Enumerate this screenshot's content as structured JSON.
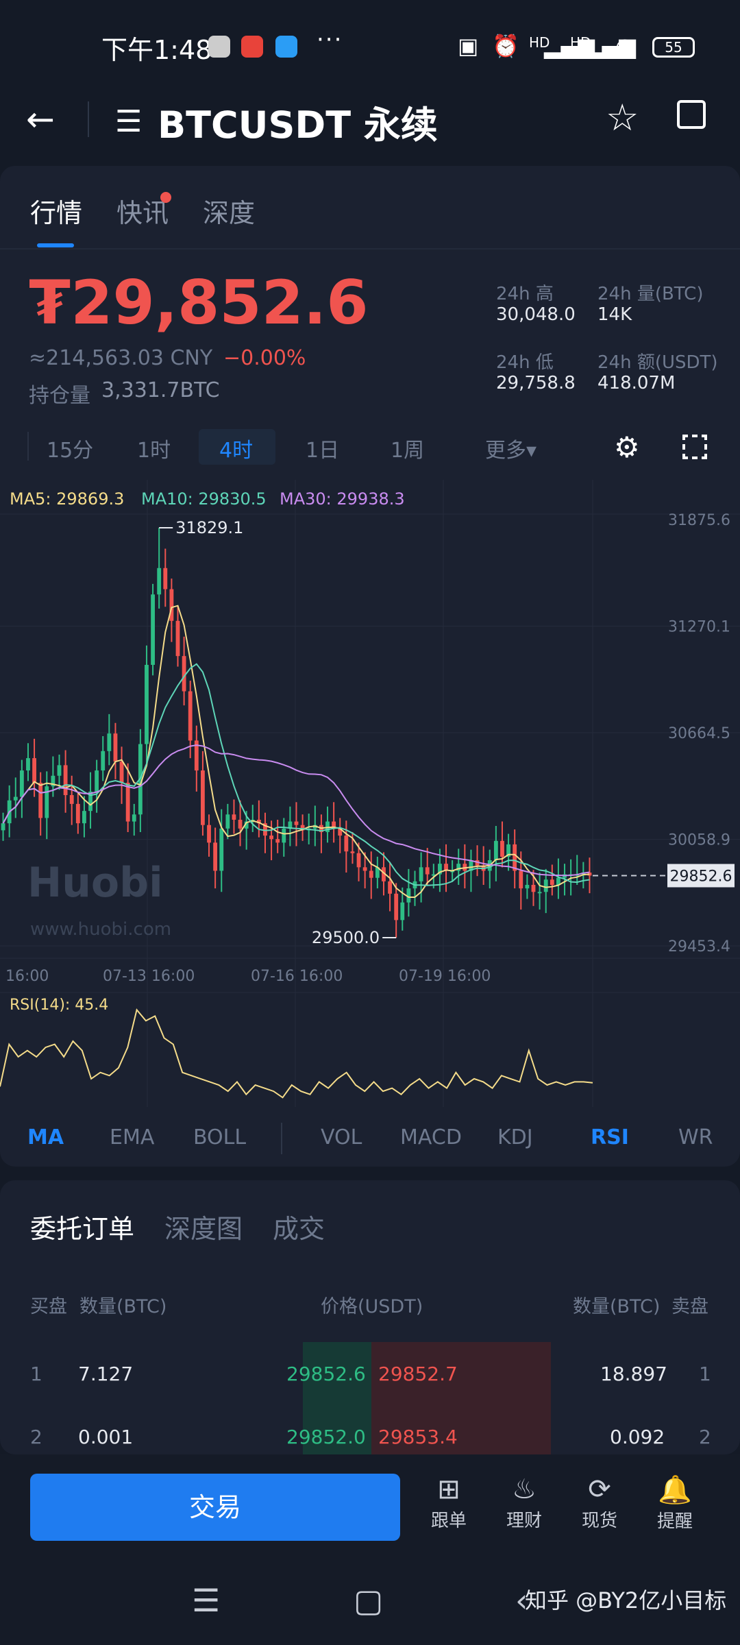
{
  "status_bar": {
    "time": "下午1:48",
    "battery": "55",
    "dots": "···",
    "hd1": "HD",
    "hd2": "HD"
  },
  "header": {
    "title": "BTCUSDT 永续",
    "back": "←",
    "menu": "☰"
  },
  "tabs": [
    {
      "label": "行情"
    },
    {
      "label": "快讯"
    },
    {
      "label": "深度"
    }
  ],
  "ticker": {
    "price": "₮29,852.6",
    "cny": "≈214,563.03 CNY",
    "change": "−0.00%",
    "position_label": "持仓量",
    "position_value": "3,331.7BTC",
    "high_label": "24h 高",
    "high": "30,048.0",
    "low_label": "24h 低",
    "low": "29,758.8",
    "vol_label": "24h 量(BTC)",
    "vol": "14K",
    "amt_label": "24h 额(USDT)",
    "amt": "418.07M"
  },
  "intervals": [
    "15分",
    "1时",
    "4时",
    "1日",
    "1周",
    "更多▾"
  ],
  "active_interval": "4时",
  "chart_data": {
    "type": "candlestick",
    "ma_labels": {
      "ma5": "MA5: 29869.3",
      "ma10": "MA10: 29830.5",
      "ma30": "MA30: 29938.3"
    },
    "y_ticks": [
      "31875.6",
      "31270.1",
      "30664.5",
      "30058.9",
      "29453.4"
    ],
    "ylim": [
      29453.4,
      31875.6
    ],
    "x_ticks": [
      "16:00",
      "07-13 16:00",
      "07-16 16:00",
      "07-19 16:00"
    ],
    "high_annotation": "31829.1",
    "low_annotation": "29500.0",
    "last_price": "29852.6",
    "watermark": "Huobi",
    "watermark_url": "www.huobi.com",
    "rsi_label": "RSI(14): 45.4",
    "colors": {
      "up": "#2ebd85",
      "down": "#f0544f",
      "ma5": "#f5dc8a",
      "ma10": "#5ed6b8",
      "ma30": "#c98cf0"
    },
    "closes": [
      30150,
      30280,
      30300,
      30450,
      30520,
      30380,
      30180,
      30360,
      30420,
      30480,
      30310,
      30260,
      30150,
      30220,
      30330,
      30450,
      30560,
      30660,
      30500,
      30380,
      30160,
      30200,
      30600,
      31050,
      31450,
      31600,
      31480,
      31300,
      31100,
      30900,
      30620,
      30450,
      30140,
      30040,
      29880,
      30120,
      30200,
      30170,
      30120,
      30160,
      30170,
      30150,
      30080,
      30060,
      30040,
      30120,
      30160,
      30140,
      30110,
      30120,
      30140,
      30100,
      30160,
      30120,
      30080,
      29990,
      29980,
      29900,
      29880,
      29840,
      29900,
      29820,
      29750,
      29600,
      29700,
      29780,
      29820,
      29900,
      29860,
      29860,
      29920,
      29880,
      29880,
      29920,
      29880,
      29940,
      29910,
      29880,
      29940,
      30050,
      29960,
      30030,
      29880,
      29780,
      29800,
      29760,
      29760,
      29830,
      29800,
      29840,
      29860,
      29860,
      29860,
      29870,
      29852.6
    ],
    "rsi": [
      43,
      70,
      62,
      66,
      62,
      68,
      70,
      62,
      72,
      66,
      48,
      52,
      50,
      55,
      68,
      92,
      85,
      88,
      74,
      70,
      52,
      50,
      48,
      46,
      44,
      40,
      46,
      38,
      44,
      42,
      40,
      36,
      44,
      40,
      38,
      46,
      42,
      48,
      52,
      44,
      40,
      46,
      40,
      42,
      38,
      44,
      48,
      42,
      46,
      42,
      52,
      44,
      48,
      46,
      42,
      50,
      48,
      46,
      66,
      48,
      44,
      46,
      44,
      46,
      46,
      45.4
    ]
  },
  "indicators_main": [
    "MA",
    "EMA",
    "BOLL"
  ],
  "indicators_sub": [
    "VOL",
    "MACD",
    "KDJ",
    "RSI",
    "WR"
  ],
  "order_tabs": [
    {
      "label": "委托订单"
    },
    {
      "label": "深度图"
    },
    {
      "label": "成交"
    }
  ],
  "order_headers": {
    "bid": "买盘",
    "qty_bid": "数量(BTC)",
    "price": "价格(USDT)",
    "qty_ask": "数量(BTC)",
    "ask": "卖盘"
  },
  "orders": [
    {
      "idx": "1",
      "bid_qty": "7.127",
      "bid_price": "29852.6",
      "ask_price": "29852.7",
      "ask_qty": "18.897",
      "ask_idx": "1"
    },
    {
      "idx": "2",
      "bid_qty": "0.001",
      "bid_price": "29852.0",
      "ask_price": "29853.4",
      "ask_qty": "0.092",
      "ask_idx": "2"
    }
  ],
  "bottom": {
    "trade": "交易",
    "items": [
      {
        "label": "跟单"
      },
      {
        "label": "理财"
      },
      {
        "label": "现货"
      },
      {
        "label": "提醒"
      }
    ]
  },
  "watermark_text": "知乎 @BY2亿小目标"
}
